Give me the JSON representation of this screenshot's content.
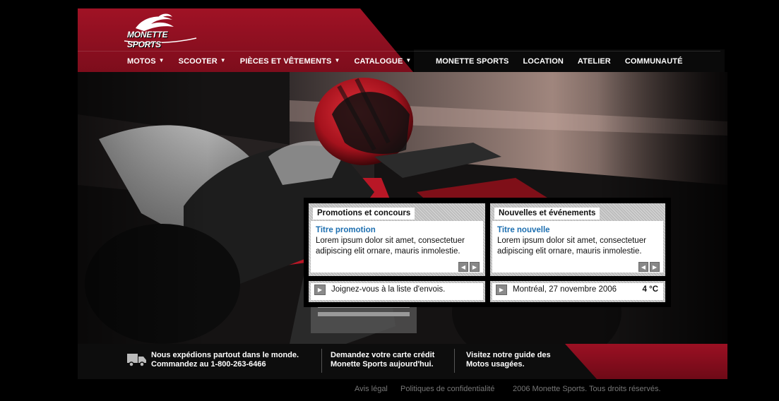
{
  "logo": {
    "text": "MONETTE SPORTS",
    "icon": "motorcycle-rider-logo"
  },
  "nav": {
    "left": [
      {
        "label": "MOTOS",
        "dropdown": true
      },
      {
        "label": "SCOOTER",
        "dropdown": true
      },
      {
        "label": "PIÈCES ET VÊTEMENTS",
        "dropdown": true
      },
      {
        "label": "CATALOGUE",
        "dropdown": true
      }
    ],
    "right": [
      {
        "label": "MONETTE SPORTS"
      },
      {
        "label": "LOCATION"
      },
      {
        "label": "ATELIER"
      },
      {
        "label": "COMMUNAUTÉ"
      }
    ]
  },
  "promotions": {
    "heading": "Promotions et concours",
    "item_title": "Titre promotion",
    "item_text": "Lorem ipsum dolor sit amet, consectetuer adipiscing elit ornare, mauris inmolestie."
  },
  "news": {
    "heading": "Nouvelles et événements",
    "item_title": "Titre nouvelle",
    "item_text": "Lorem ipsum dolor sit amet, consectetuer adipiscing elit ornare, mauris inmolestie."
  },
  "newsletter": {
    "label": "Joignez-vous à la liste d'envois."
  },
  "weather": {
    "label": "Montréal, 27 novembre 2006",
    "temp": "4 °C"
  },
  "footer": {
    "shipping_line1": "Nous expédions partout dans le monde.",
    "shipping_line2": "Commandez au 1-800-263-6466",
    "credit_line1": "Demandez votre carte crédit",
    "credit_line2": "Monette Sports aujourd'hui.",
    "guide_line1": "Visitez notre guide des",
    "guide_line2": "Motos usagées."
  },
  "legal": {
    "notice": "Avis légal",
    "privacy": "Politiques de confidentialité",
    "copyright": "2006 Monette Sports. Tous droits réservés."
  },
  "colors": {
    "brand_red": "#a01225",
    "link_blue": "#1d6fb0",
    "background": "#000000"
  }
}
